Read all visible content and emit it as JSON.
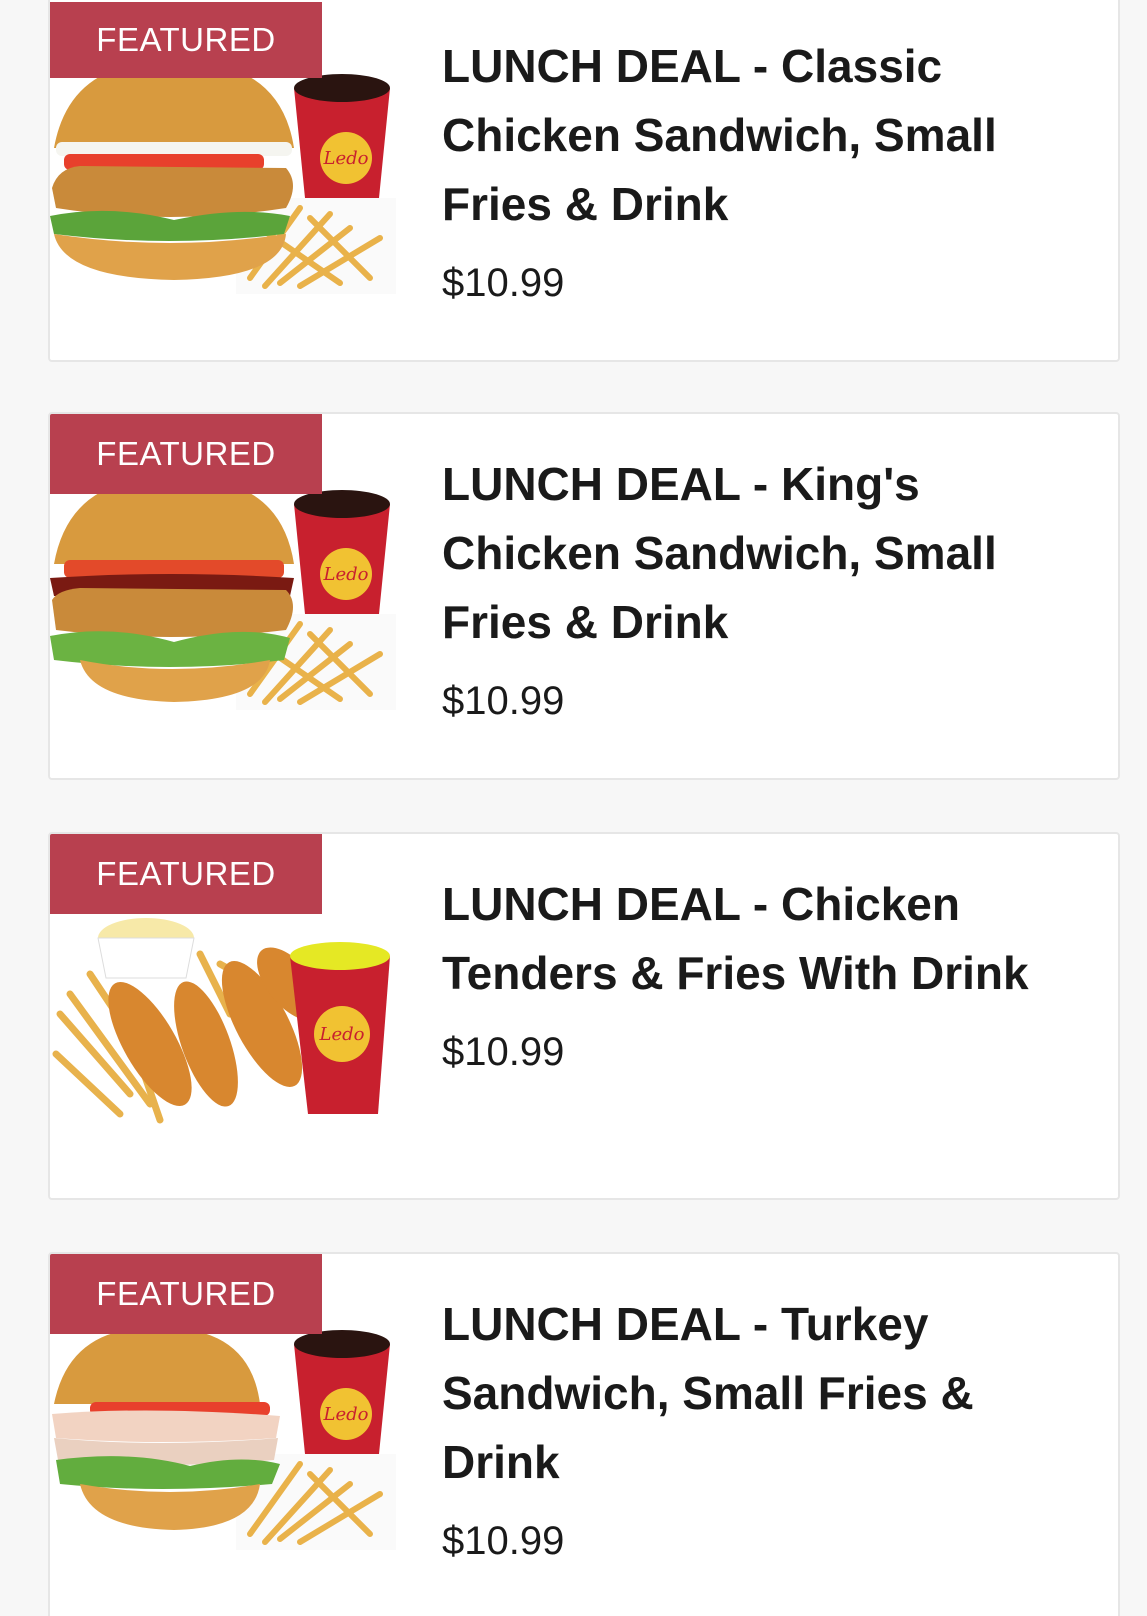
{
  "brand_color": "#b8404f",
  "items": [
    {
      "badge": "FEATURED",
      "title": "LUNCH DEAL - Classic Chicken Sandwich, Small Fries & Drink",
      "price": "$10.99",
      "image": "classic-chicken-sandwich-combo-image"
    },
    {
      "badge": "FEATURED",
      "title": "LUNCH DEAL - King's Chicken Sandwich, Small Fries & Drink",
      "price": "$10.99",
      "image": "kings-chicken-sandwich-combo-image"
    },
    {
      "badge": "FEATURED",
      "title": "LUNCH DEAL - Chicken Tenders & Fries With Drink",
      "price": "$10.99",
      "image": "chicken-tenders-combo-image"
    },
    {
      "badge": "FEATURED",
      "title": "LUNCH DEAL - Turkey Sandwich, Small Fries & Drink",
      "price": "$10.99",
      "image": "turkey-sandwich-combo-image"
    }
  ]
}
